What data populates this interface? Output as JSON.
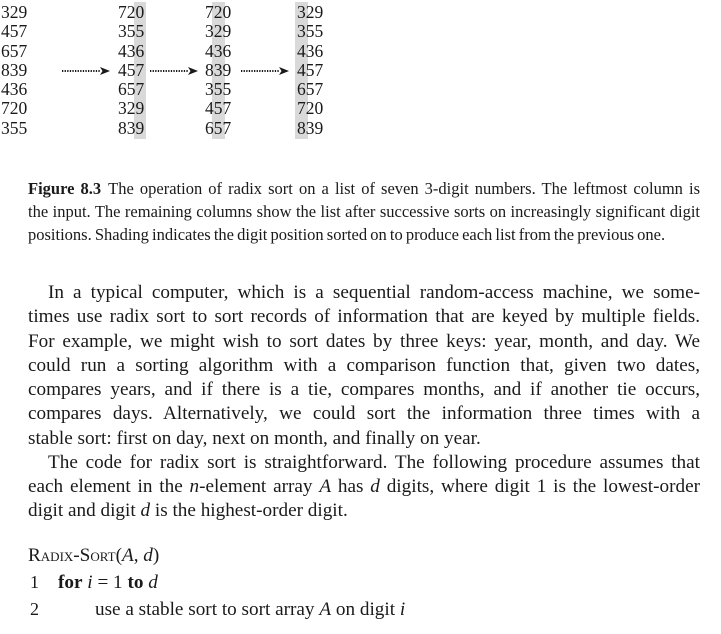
{
  "colors": {
    "text": "#1a1a1a",
    "background": "#ffffff",
    "shading": "#d9d9d9"
  },
  "figure": {
    "arrow_icon": "dotted-arrow-icon",
    "columns": [
      {
        "values": [
          "329",
          "457",
          "657",
          "839",
          "436",
          "720",
          "355"
        ],
        "sorted_on_digit": null
      },
      {
        "values": [
          "720",
          "355",
          "436",
          "457",
          "657",
          "329",
          "839"
        ],
        "sorted_on_digit": 1
      },
      {
        "values": [
          "720",
          "329",
          "436",
          "839",
          "355",
          "457",
          "657"
        ],
        "sorted_on_digit": 2
      },
      {
        "values": [
          "329",
          "355",
          "436",
          "457",
          "657",
          "720",
          "839"
        ],
        "sorted_on_digit": 3
      }
    ],
    "caption": {
      "label": "Figure 8.3",
      "lines": [
        "The operation of radix sort on a list of seven 3-digit numbers. The leftmost column is",
        "the input. The remaining columns show the list after successive sorts on increasingly significant digit",
        "positions. Shading indicates the digit position sorted on to produce each list from the previous one."
      ]
    }
  },
  "body": {
    "paragraphs": [
      {
        "lines": [
          "In a typical computer, which is a sequential random-access machine, we some-",
          "times use radix sort to sort records of information that are keyed by multiple fields.",
          "For example, we might wish to sort dates by three keys: year, month, and day. We",
          "could run a sorting algorithm with a comparison function that, given two dates,",
          "compares years, and if there is a tie, compares months, and if another tie occurs,",
          "compares days. Alternatively, we could sort the information three times with a",
          "stable sort: first on day, next on month, and finally on year."
        ]
      },
      {
        "lines": [
          "The code for radix sort is straightforward. The following procedure assumes that",
          [
            "each element in the ",
            {
              "text": "n",
              "style": "math"
            },
            "-element array ",
            {
              "text": "A",
              "style": "math"
            },
            " has ",
            {
              "text": "d",
              "style": "math"
            },
            " digits, where digit 1 is the lowest-order"
          ],
          [
            "digit and digit ",
            {
              "text": "d",
              "style": "math"
            },
            " is the highest-order digit."
          ]
        ]
      }
    ]
  },
  "algorithm": {
    "name": "Radix-Sort",
    "signature": [
      "(",
      {
        "text": "A",
        "style": "math"
      },
      ", ",
      {
        "text": "d",
        "style": "math"
      },
      ")"
    ],
    "lines": [
      {
        "number": "1",
        "content": [
          {
            "text": "for",
            "style": "keyword"
          },
          " ",
          {
            "text": "i",
            "style": "math"
          },
          " = 1 ",
          {
            "text": "to",
            "style": "keyword"
          },
          " ",
          {
            "text": "d",
            "style": "math"
          }
        ]
      },
      {
        "number": "2",
        "content": [
          "use a stable sort to sort array ",
          {
            "text": "A",
            "style": "math"
          },
          " on digit ",
          {
            "text": "i",
            "style": "math"
          }
        ]
      }
    ]
  }
}
